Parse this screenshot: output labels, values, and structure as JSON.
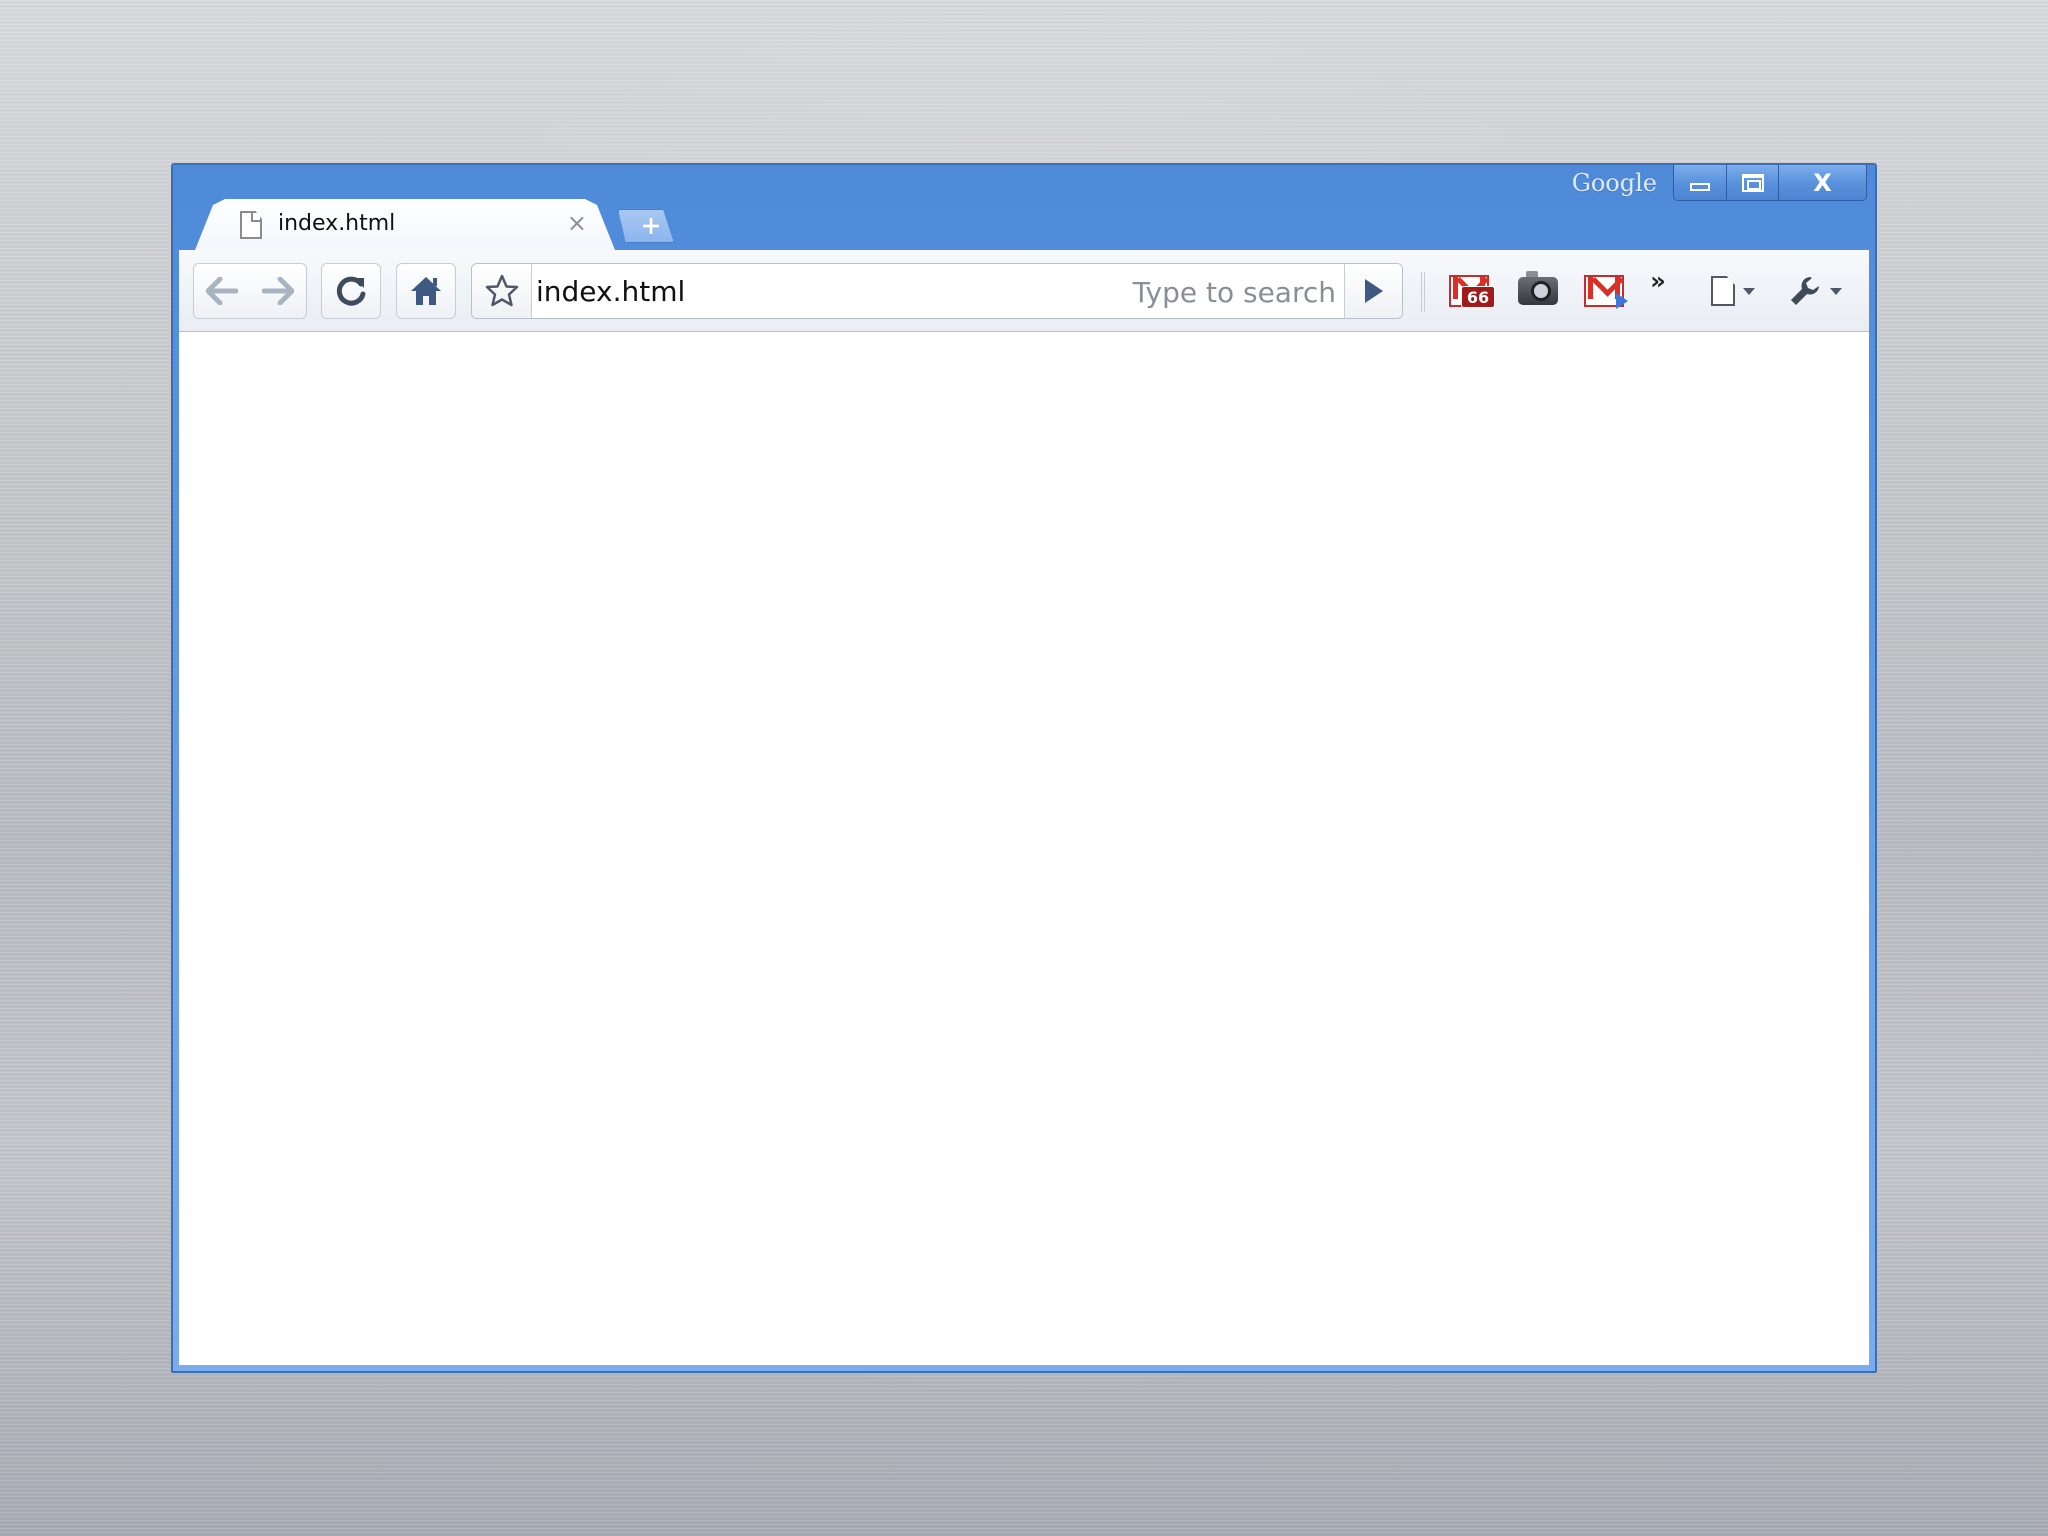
{
  "window": {
    "brand": "Google",
    "controls": {
      "close_label": "X"
    }
  },
  "tab": {
    "title": "index.html",
    "close_label": "×"
  },
  "newtab": {
    "label": "+"
  },
  "toolbar": {
    "back_icon": "back-arrow-icon",
    "forward_icon": "forward-arrow-icon",
    "reload_glyph": "C",
    "omnibox": {
      "url": "index.html",
      "search_hint": "Type to search"
    },
    "extensions": {
      "gmail_badge": "66",
      "overflow_label": "»"
    }
  },
  "colors": {
    "frame_blue": "#5b93de",
    "gmail_red": "#d93025",
    "badge_red": "#a21b1b"
  }
}
